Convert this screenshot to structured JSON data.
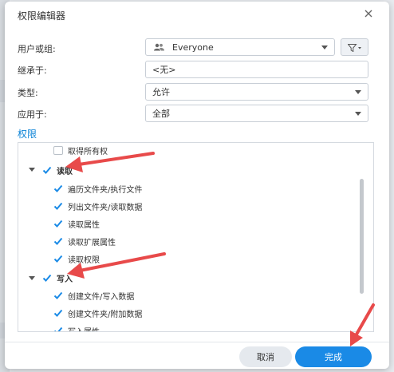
{
  "dialog": {
    "title": "权限编辑器"
  },
  "form": {
    "user_label": "用户或组:",
    "user_value": "Everyone",
    "inherit_label": "继承于:",
    "inherit_value": "<无>",
    "type_label": "类型:",
    "type_value": "允许",
    "apply_label": "应用于:",
    "apply_value": "全部"
  },
  "permissions": {
    "title": "权限",
    "rows": [
      {
        "label": "取得所有权",
        "checked": false
      },
      {
        "label": "读取",
        "checked": true
      },
      {
        "label": "遍历文件夹/执行文件",
        "checked": true
      },
      {
        "label": "列出文件夹/读取数据",
        "checked": true
      },
      {
        "label": "读取属性",
        "checked": true
      },
      {
        "label": "读取扩展属性",
        "checked": true
      },
      {
        "label": "读取权限",
        "checked": true
      },
      {
        "label": "写入",
        "checked": true
      },
      {
        "label": "创建文件/写入数据",
        "checked": true
      },
      {
        "label": "创建文件夹/附加数据",
        "checked": true
      },
      {
        "label": "写入属性",
        "checked": true
      }
    ]
  },
  "buttons": {
    "cancel": "取消",
    "done": "完成"
  },
  "colors": {
    "accent": "#1a8ae6",
    "section_title": "#0b83d6",
    "annotation_arrow": "#e84a4a"
  },
  "icons": [
    "close-icon",
    "user-group-icon",
    "filter-icon",
    "chevron-down-icon",
    "checkmark-icon",
    "expand-arrow-icon",
    "annotation-arrow"
  ]
}
